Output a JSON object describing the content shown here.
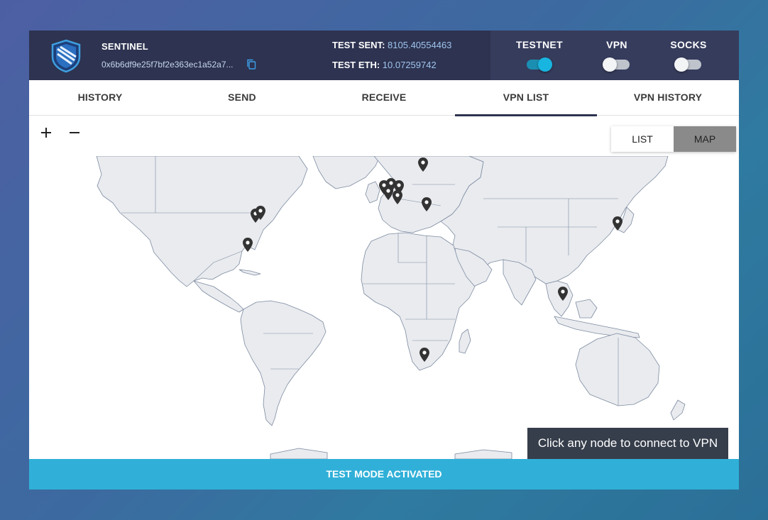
{
  "header": {
    "brand": "SENTINEL",
    "address": "0x6b6df9e25f7bf2e363ec1a52a7...",
    "balances": {
      "sent_label": "TEST SENT:",
      "sent_value": "8105.40554463",
      "eth_label": "TEST ETH:",
      "eth_value": "10.07259742"
    },
    "toggles": [
      {
        "label": "TESTNET",
        "on": true
      },
      {
        "label": "VPN",
        "on": false
      },
      {
        "label": "SOCKS",
        "on": false
      }
    ]
  },
  "tabs": [
    {
      "label": "HISTORY",
      "active": false
    },
    {
      "label": "SEND",
      "active": false
    },
    {
      "label": "RECEIVE",
      "active": false
    },
    {
      "label": "VPN LIST",
      "active": true
    },
    {
      "label": "VPN HISTORY",
      "active": false
    }
  ],
  "map_controls": {
    "zoom_in_icon": "plus-icon",
    "zoom_out_icon": "minus-icon",
    "views": [
      {
        "label": "LIST",
        "active": false
      },
      {
        "label": "MAP",
        "active": true
      }
    ]
  },
  "hint": "Click any node to connect to VPN",
  "footer": "TEST MODE ACTIVATED",
  "colors": {
    "header_bg": "#2d3350",
    "header_right_bg": "#363c5c",
    "accent": "#30b0d8",
    "toggle_on": "#18b5e0",
    "land": "#e9ebef",
    "border": "#7d8ba0",
    "marker": "#333333",
    "hint_bg": "#363e4b"
  }
}
